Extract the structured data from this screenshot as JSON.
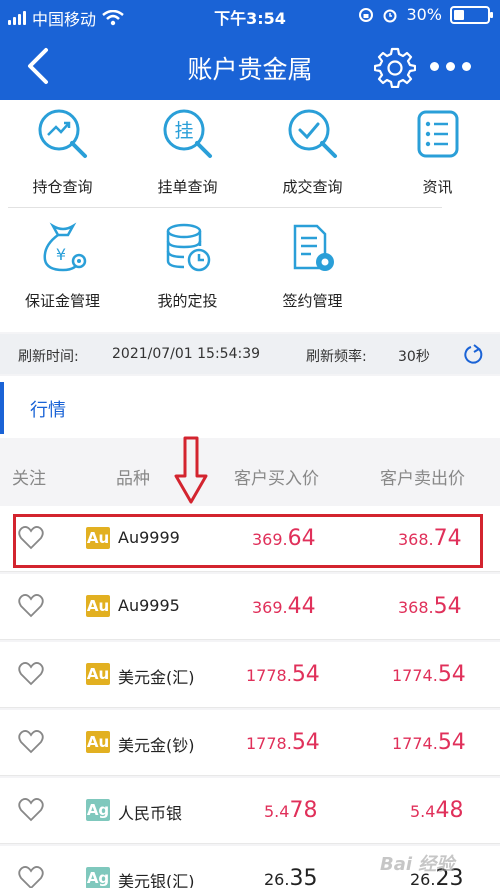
{
  "status": {
    "carrier": "中国移动",
    "time": "下午3:54",
    "battery": "30%",
    "battery_level": 0.3
  },
  "nav": {
    "title": "账户贵金属"
  },
  "functions": [
    {
      "label": "持仓查询",
      "icon": "chart-search-icon"
    },
    {
      "label": "挂单查询",
      "icon": "order-search-icon",
      "glyph": "挂"
    },
    {
      "label": "成交查询",
      "icon": "check-search-icon"
    },
    {
      "label": "资讯",
      "icon": "list-icon"
    },
    {
      "label": "保证金管理",
      "icon": "money-bag-icon",
      "glyph": "¥"
    },
    {
      "label": "我的定投",
      "icon": "database-clock-icon"
    },
    {
      "label": "签约管理",
      "icon": "document-gear-icon"
    }
  ],
  "refresh": {
    "time_label": "刷新时间:",
    "time_value": "2021/07/01 15:54:39",
    "freq_label": "刷新频率:",
    "freq_value": "30秒"
  },
  "tab": {
    "label": "行情"
  },
  "table": {
    "headers": [
      "关注",
      "品种",
      "客户买入价",
      "客户卖出价"
    ],
    "rows": [
      {
        "badge": "Au",
        "name": "Au9999",
        "buy_small": "369.",
        "buy_big": "64",
        "sell_small": "368.",
        "sell_big": "74",
        "color": "#e0305a"
      },
      {
        "badge": "Au",
        "name": "Au9995",
        "buy_small": "369.",
        "buy_big": "44",
        "sell_small": "368.",
        "sell_big": "54",
        "color": "#e0305a"
      },
      {
        "badge": "Au",
        "name": "美元金(汇)",
        "buy_small": "1778.",
        "buy_big": "54",
        "sell_small": "1774.",
        "sell_big": "54",
        "color": "#e0305a"
      },
      {
        "badge": "Au",
        "name": "美元金(钞)",
        "buy_small": "1778.",
        "buy_big": "54",
        "sell_small": "1774.",
        "sell_big": "54",
        "color": "#e0305a"
      },
      {
        "badge": "Ag",
        "name": "人民币银",
        "buy_small": "5.4",
        "buy_big": "78",
        "sell_small": "5.4",
        "sell_big": "48",
        "color": "#e0305a"
      },
      {
        "badge": "Ag",
        "name": "美元银(汇)",
        "buy_small": "26.",
        "buy_big": "35",
        "sell_small": "26.",
        "sell_big": "23",
        "color": "#222222"
      }
    ]
  },
  "colors": {
    "primary": "#1a63d6",
    "gold": "#e2b021",
    "silver": "#7fc8bd",
    "price_red": "#e0305a",
    "highlight_red": "#d3242f"
  },
  "watermark": "Bai 经验"
}
